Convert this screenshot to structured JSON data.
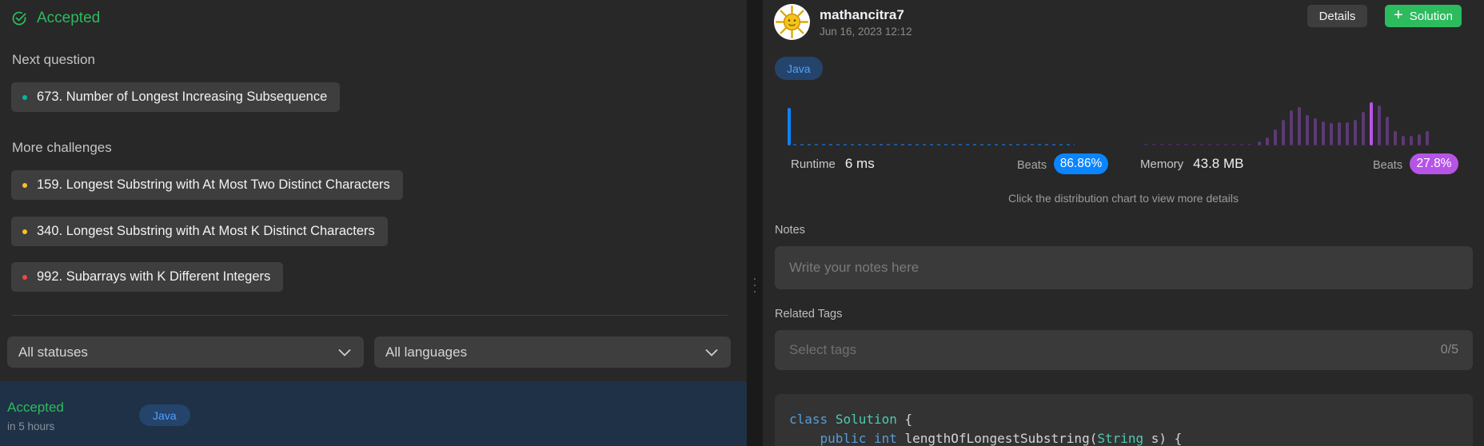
{
  "left": {
    "status_title": "Accepted",
    "next_label": "Next question",
    "next_question": {
      "text": "673. Number of Longest Increasing Subsequence",
      "difficulty_color": "#00b8a3"
    },
    "more_label": "More challenges",
    "challenges": [
      {
        "text": "159. Longest Substring with At Most Two Distinct Characters",
        "difficulty_color": "#ffc01e"
      },
      {
        "text": "340. Longest Substring with At Most K Distinct Characters",
        "difficulty_color": "#ffc01e"
      },
      {
        "text": "992. Subarrays with K Different Integers",
        "difficulty_color": "#ef4743"
      }
    ],
    "filters": {
      "status": "All statuses",
      "language": "All languages"
    },
    "submission": {
      "status": "Accepted",
      "time": "in 5 hours",
      "language": "Java"
    }
  },
  "right": {
    "username": "mathancitra7",
    "date": "Jun 16, 2023 12:12",
    "details_label": "Details",
    "solution_label": "Solution",
    "language": "Java",
    "runtime": {
      "label": "Runtime",
      "value": "6 ms",
      "beats_label": "Beats",
      "beats_value": "86.86%",
      "color": "#0a84ff"
    },
    "memory": {
      "label": "Memory",
      "value": "43.8 MB",
      "beats_label": "Beats",
      "beats_value": "27.8%",
      "color": "#b654e8"
    },
    "hint": "Click the distribution chart to view more details",
    "notes_label": "Notes",
    "notes_placeholder": "Write your notes here",
    "tags_label": "Related Tags",
    "tags_placeholder": "Select tags",
    "tags_count": "0/5",
    "code_lines": [
      "class Solution {",
      "    public int lengthOfLongestSubstring(String s) {"
    ]
  },
  "icons": {
    "accepted": "check-circle-icon",
    "chevron": "chevron-down-icon",
    "plus": "plus-icon",
    "avatar": "sun-avatar-icon"
  },
  "colors": {
    "accent_green": "#2cbb5d",
    "runtime_blue": "#0a84ff",
    "memory_purple": "#b654e8"
  }
}
